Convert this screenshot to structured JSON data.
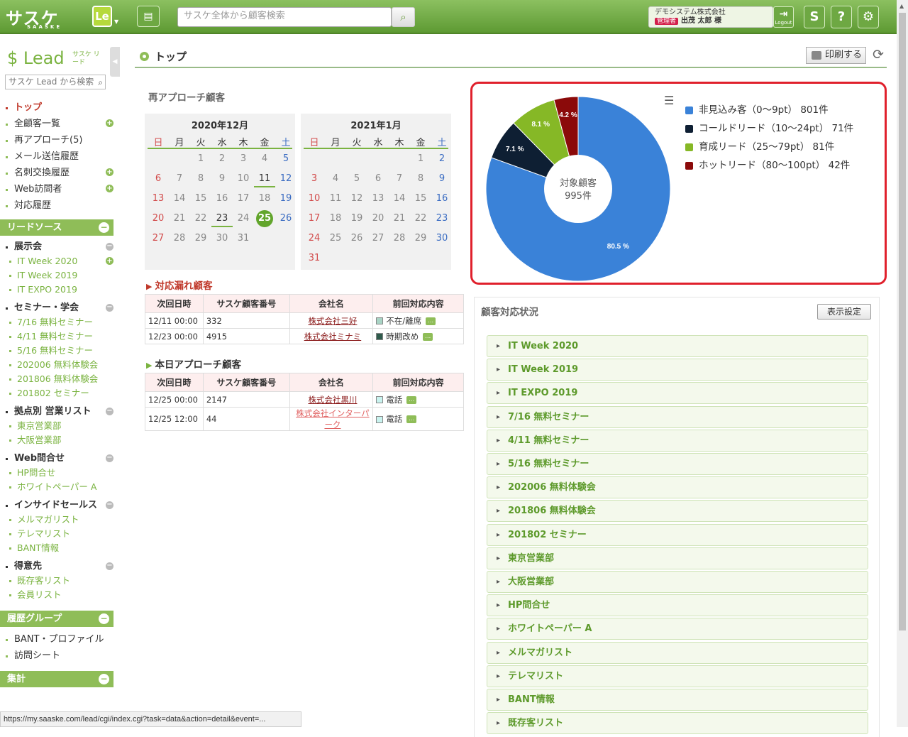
{
  "header": {
    "logo_text": "サスケ",
    "logo_sub": "SAASKE",
    "le_label": "Le",
    "search_placeholder": "サスケ全体から顧客検索",
    "company": "デモシステム株式会社",
    "role_badge": "管理者",
    "user_name": "出茂 太郎 様",
    "logout_label": "Logout",
    "help_label": "?",
    "home_label": "S"
  },
  "sidebar": {
    "product_name": "Lead",
    "product_sub": "サスケ リード",
    "search_placeholder": "サスケ Lead から検索",
    "nav": [
      {
        "label": "トップ",
        "active": true
      },
      {
        "label": "全顧客一覧",
        "plus": true
      },
      {
        "label": "再アプローチ(5)"
      },
      {
        "label": "メール送信履歴"
      },
      {
        "label": "名刺交換履歴",
        "plus": true
      },
      {
        "label": "Web訪問者",
        "plus": true
      },
      {
        "label": "対応履歴"
      }
    ],
    "lead_source_title": "リードソース",
    "groups": [
      {
        "title": "展示会",
        "items": [
          "IT Week 2020",
          "IT Week 2019",
          "IT EXPO 2019"
        ]
      },
      {
        "title": "セミナー・学会",
        "items": [
          "7/16 無料セミナー",
          "4/11 無料セミナー",
          "5/16 無料セミナー",
          "202006 無料体験会",
          "201806 無料体験会",
          "201802 セミナー"
        ]
      },
      {
        "title": "拠点別 営業リスト",
        "items": [
          "東京営業部",
          "大阪営業部"
        ]
      },
      {
        "title": "Web問合せ",
        "items": [
          "HP問合せ",
          "ホワイトペーパー A"
        ]
      },
      {
        "title": "インサイドセールス",
        "items": [
          "メルマガリスト",
          "テレマリスト",
          "BANT情報"
        ]
      },
      {
        "title": "得意先",
        "items": [
          "既存客リスト",
          "会員リスト"
        ]
      }
    ],
    "history_title": "履歴グループ",
    "history_items": [
      "BANT・プロファイル",
      "訪問シート"
    ],
    "aggregate_title": "集計"
  },
  "page": {
    "title": "トップ",
    "print_label": "印刷する"
  },
  "reapproach": {
    "title": "再アプローチ顧客",
    "weekdays": [
      "日",
      "月",
      "火",
      "水",
      "木",
      "金",
      "土"
    ],
    "cal1_title": "2020年12月",
    "cal2_title": "2021年1月"
  },
  "missed": {
    "title": "対応漏れ顧客",
    "headers": [
      "次回日時",
      "サスケ顧客番号",
      "会社名",
      "前回対応内容"
    ],
    "rows": [
      {
        "date": "12/11 00:00",
        "no": "332",
        "company": "株式会社三好",
        "status": "不在/離席",
        "color": "#a9d4c5"
      },
      {
        "date": "12/23 00:00",
        "no": "4915",
        "company": "株式会社ミナミ",
        "status": "時期改め",
        "color": "#2f5b4c"
      }
    ]
  },
  "today": {
    "title": "本日アプローチ顧客",
    "headers": [
      "次回日時",
      "サスケ顧客番号",
      "会社名",
      "前回対応内容"
    ],
    "rows": [
      {
        "date": "12/25 00:00",
        "no": "2147",
        "company": "株式会社黒川",
        "status": "電話",
        "color": "#c9f3ef"
      },
      {
        "date": "12/25 12:00",
        "no": "44",
        "company": "株式会社インターパーク",
        "status": "電話",
        "color": "#c9f3ef"
      }
    ]
  },
  "chart_data": {
    "type": "pie",
    "center_label": "対象顧客",
    "center_value": "995件",
    "categories": [
      "非見込み客（0〜9pt） 801件",
      "コールドリード（10〜24pt） 71件",
      "育成リード（25〜79pt） 81件",
      "ホットリード（80〜100pt） 42件"
    ],
    "values": [
      801,
      71,
      81,
      42
    ],
    "percent_labels": [
      "80.5 %",
      "7.1 %",
      "8.1 %",
      "4.2 %"
    ],
    "colors": [
      "#3a82d8",
      "#0e1f33",
      "#86b826",
      "#8b0a0a"
    ]
  },
  "status_panel": {
    "title": "顧客対応状況",
    "settings_label": "表示設定",
    "items": [
      "IT Week 2020",
      "IT Week 2019",
      "IT EXPO 2019",
      "7/16 無料セミナー",
      "4/11 無料セミナー",
      "5/16 無料セミナー",
      "202006 無料体験会",
      "201806 無料体験会",
      "201802 セミナー",
      "東京営業部",
      "大阪営業部",
      "HP問合せ",
      "ホワイトペーパー A",
      "メルマガリスト",
      "テレマリスト",
      "BANT情報",
      "既存客リスト"
    ]
  },
  "status_url": "https://my.saaske.com/lead/cgi/index.cgi?task=data&action=detail&event=..."
}
